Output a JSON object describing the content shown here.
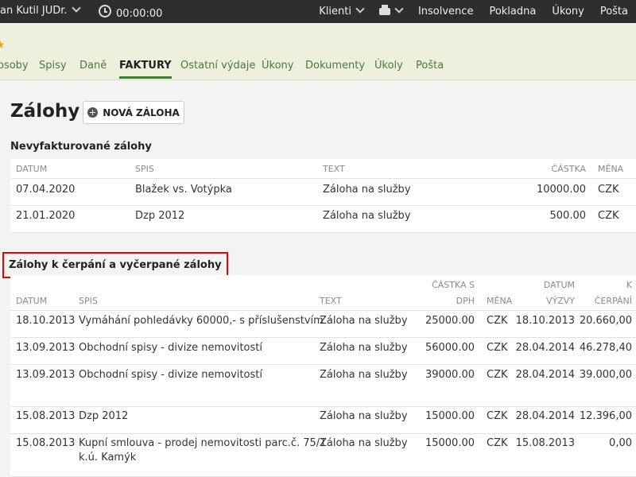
{
  "topbar": {
    "user_name": "an Kutil JUDr.",
    "timer": "00:00:00",
    "nav": [
      "Klienti",
      "Insolvence",
      "Pokladna",
      "Úkony",
      "Pošta"
    ]
  },
  "tabs": [
    "osoby",
    "Spisy",
    "Daně",
    "FAKTURY",
    "Ostatní výdaje",
    "Úkony",
    "Dokumenty",
    "Úkoly",
    "Pošta"
  ],
  "active_tab": "FAKTURY",
  "page": {
    "title": "Zálohy",
    "new_button": "NOVÁ ZÁLOHA"
  },
  "unbilled": {
    "title": "Nevyfakturované zálohy",
    "headers": {
      "datum": "DATUM",
      "spis": "SPIS",
      "text": "TEXT",
      "castka": "ČÁSTKA",
      "mena": "MĚNA"
    },
    "rows": [
      {
        "datum": "07.04.2020",
        "spis": "Blažek vs. Votýpka",
        "text": "Záloha na služby",
        "castka": "10000.00",
        "mena": "CZK"
      },
      {
        "datum": "21.01.2020",
        "spis": "Dzp 2012",
        "text": "Záloha na služby",
        "castka": "500.00",
        "mena": "CZK"
      }
    ]
  },
  "drawing": {
    "title": "Zálohy k čerpání a vyčerpané zálohy",
    "headers": {
      "datum": "DATUM",
      "spis": "SPIS",
      "text": "TEXT",
      "castka_1": "ČÁSTKA S",
      "castka_2": "DPH",
      "mena": "MĚNA",
      "vyzvy_1": "DATUM",
      "vyzvy_2": "VÝZVY",
      "cerpani_1": "K",
      "cerpani_2": "ČERPÁNÍ"
    },
    "rows": [
      {
        "datum": "18.10.2013",
        "spis": "Vymáhání pohledávky 60000,- s příslušenstvím",
        "spis2": "",
        "text": "Záloha na služby",
        "castka": "25000.00",
        "mena": "CZK",
        "vyzvy": "18.10.2013",
        "cerpani": "20.660,00"
      },
      {
        "datum": "13.09.2013",
        "spis": "Obchodní spisy - divize nemovitostí",
        "spis2": "",
        "text": "Záloha na služby",
        "castka": "56000.00",
        "mena": "CZK",
        "vyzvy": "28.04.2014",
        "cerpani": "46.278,40"
      },
      {
        "datum": "13.09.2013",
        "spis": "Obchodní spisy - divize nemovitostí",
        "spis2": "",
        "text": "Záloha na služby",
        "castka": "39000.00",
        "mena": "CZK",
        "vyzvy": "28.04.2014",
        "cerpani": "39.000,00"
      },
      {
        "datum": "15.08.2013",
        "spis": "Dzp 2012",
        "spis2": "",
        "text": "Záloha na služby",
        "castka": "15000.00",
        "mena": "CZK",
        "vyzvy": "28.04.2014",
        "cerpani": "12.396,00"
      },
      {
        "datum": "15.08.2013",
        "spis": "Kupní smlouva - prodej nemovitosti parc.č. 75/1",
        "spis2": "k.ú. Kamýk",
        "text": "Záloha na služby",
        "castka": "15000.00",
        "mena": "CZK",
        "vyzvy": "15.08.2013",
        "cerpani": "0,00"
      }
    ]
  }
}
